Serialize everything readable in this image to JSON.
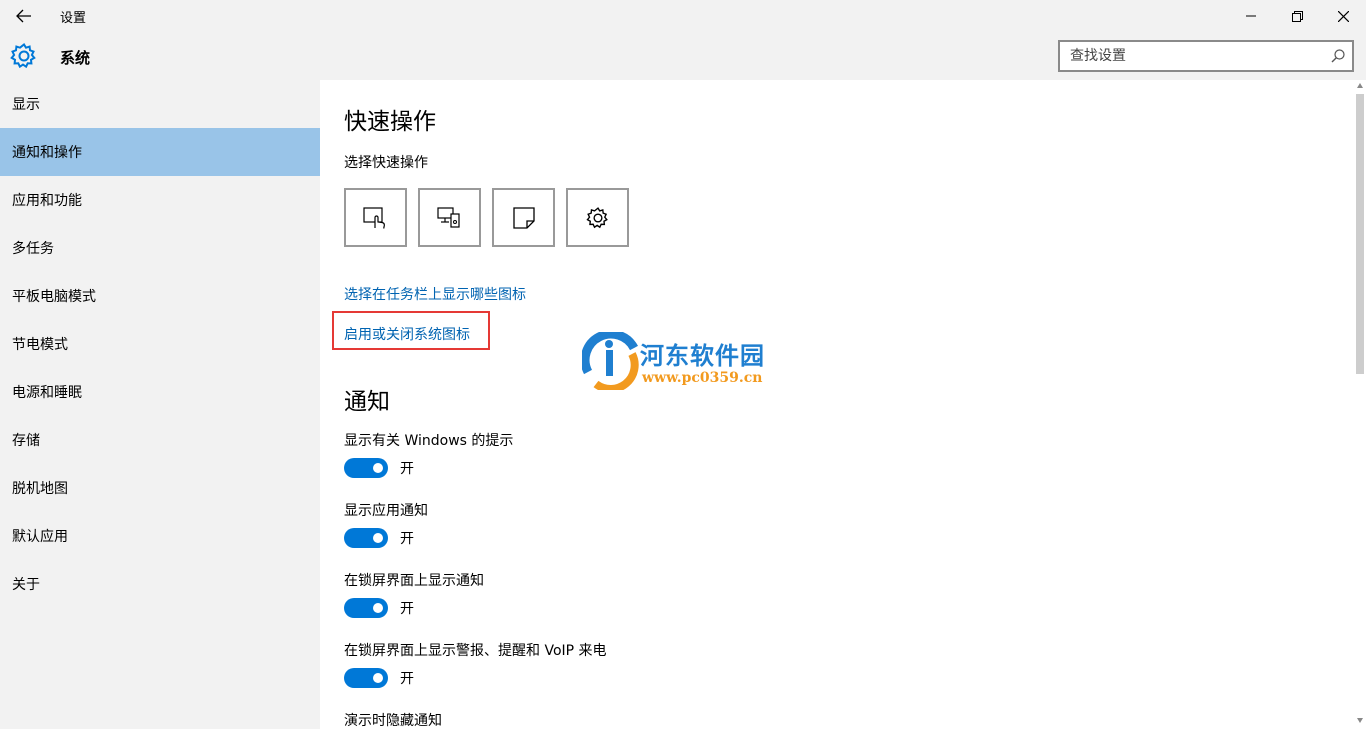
{
  "window": {
    "title": "设置"
  },
  "header": {
    "title": "系统",
    "search_placeholder": "查找设置"
  },
  "sidebar": {
    "items": [
      {
        "label": "显示"
      },
      {
        "label": "通知和操作",
        "selected": true
      },
      {
        "label": "应用和功能"
      },
      {
        "label": "多任务"
      },
      {
        "label": "平板电脑模式"
      },
      {
        "label": "节电模式"
      },
      {
        "label": "电源和睡眠"
      },
      {
        "label": "存储"
      },
      {
        "label": "脱机地图"
      },
      {
        "label": "默认应用"
      },
      {
        "label": "关于"
      }
    ]
  },
  "main": {
    "quick_actions_title": "快速操作",
    "quick_actions_subtitle": "选择快速操作",
    "quick_action_icons": [
      "tablet-mode-icon",
      "connect-icon",
      "note-icon",
      "settings-icon"
    ],
    "link_taskbar_icons": "选择在任务栏上显示哪些图标",
    "link_system_icons": "启用或关闭系统图标",
    "notifications_title": "通知",
    "toggles": [
      {
        "label": "显示有关 Windows 的提示",
        "state": "开"
      },
      {
        "label": "显示应用通知",
        "state": "开"
      },
      {
        "label": "在锁屏界面上显示通知",
        "state": "开"
      },
      {
        "label": "在锁屏界面上显示警报、提醒和 VoIP 来电",
        "state": "开"
      }
    ],
    "last_setting_label": "演示时隐藏通知"
  },
  "watermark": {
    "name": "河东软件园",
    "url": "www.pc0359.cn"
  },
  "colors": {
    "accent": "#0078d7",
    "selected_bg": "#99c4e8",
    "link": "#0063b1",
    "highlight": "#e53935"
  }
}
